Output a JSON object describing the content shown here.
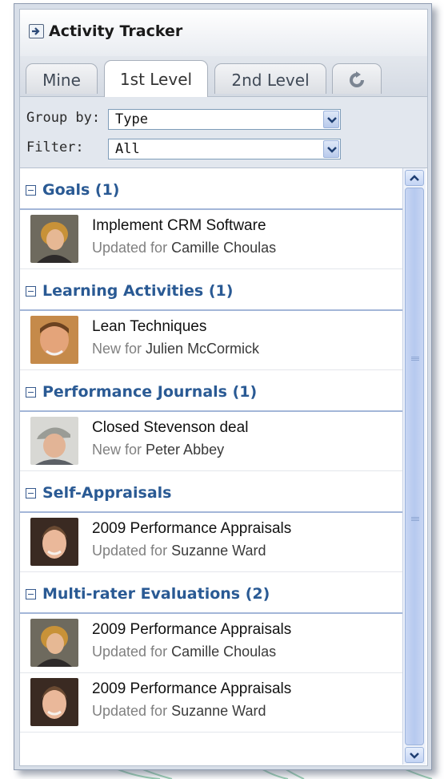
{
  "panel": {
    "title": "Activity Tracker",
    "header_icon": "export-arrow-icon"
  },
  "tabs": [
    {
      "label": "Mine",
      "active": false
    },
    {
      "label": "1st Level",
      "active": true
    },
    {
      "label": "2nd Level",
      "active": false
    },
    {
      "label": "",
      "icon": "refresh-icon",
      "active": false
    }
  ],
  "controls": {
    "group_by_label": "Group by:",
    "group_by_value": "Type",
    "filter_label": "Filter:",
    "filter_value": "All"
  },
  "groups": [
    {
      "title": "Goals (1)",
      "items": [
        {
          "title": "Implement CRM Software",
          "status": "Updated for",
          "person": "Camille Choulas",
          "avatar": "avatar-camille"
        }
      ]
    },
    {
      "title": "Learning Activities (1)",
      "items": [
        {
          "title": "Lean Techniques",
          "status": "New for",
          "person": "Julien McCormick",
          "avatar": "avatar-julien"
        }
      ]
    },
    {
      "title": "Performance Journals (1)",
      "items": [
        {
          "title": "Closed Stevenson deal",
          "status": "New for",
          "person": "Peter Abbey",
          "avatar": "avatar-peter"
        }
      ]
    },
    {
      "title": "Self-Appraisals",
      "items": [
        {
          "title": "2009 Performance Appraisals",
          "status": "Updated for",
          "person": "Suzanne Ward",
          "avatar": "avatar-suzanne"
        }
      ]
    },
    {
      "title": "Multi-rater Evaluations (2)",
      "items": [
        {
          "title": "2009 Performance Appraisals",
          "status": "Updated for",
          "person": "Camille Choulas",
          "avatar": "avatar-camille"
        },
        {
          "title": "2009 Performance Appraisals",
          "status": "Updated for",
          "person": "Suzanne Ward",
          "avatar": "avatar-suzanne"
        }
      ]
    }
  ],
  "colors": {
    "group_title": "#2a5a94",
    "group_rule": "#a3b6d8",
    "subtext": "#808080"
  }
}
